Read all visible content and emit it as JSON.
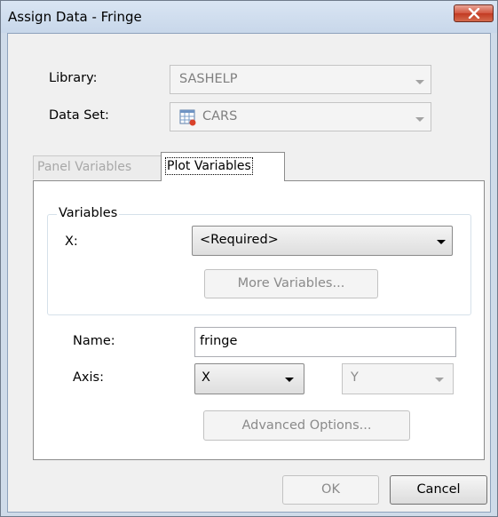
{
  "window": {
    "title": "Assign Data - Fringe"
  },
  "library": {
    "label": "Library:",
    "value": "SASHELP"
  },
  "data_set": {
    "label": "Data Set:",
    "value": "CARS",
    "icon": "table-icon"
  },
  "tabs": [
    {
      "label": "Panel Variables",
      "active": false
    },
    {
      "label": "Plot Variables",
      "active": true
    }
  ],
  "variables_group": {
    "title": "Variables",
    "x_label": "X:",
    "x_value": "<Required>",
    "more_button": "More Variables..."
  },
  "name_field": {
    "label": "Name:",
    "value": "fringe"
  },
  "axis": {
    "label": "Axis:",
    "x_value": "X",
    "y_value": "Y"
  },
  "advanced_button": "Advanced Options...",
  "footer": {
    "ok": "OK",
    "cancel": "Cancel"
  },
  "colors": {
    "title_bar": "#d3e1f1",
    "close_button": "#c84a33",
    "dialog_bg": "#f0f0f0",
    "disabled_text": "#8a8a8a"
  }
}
